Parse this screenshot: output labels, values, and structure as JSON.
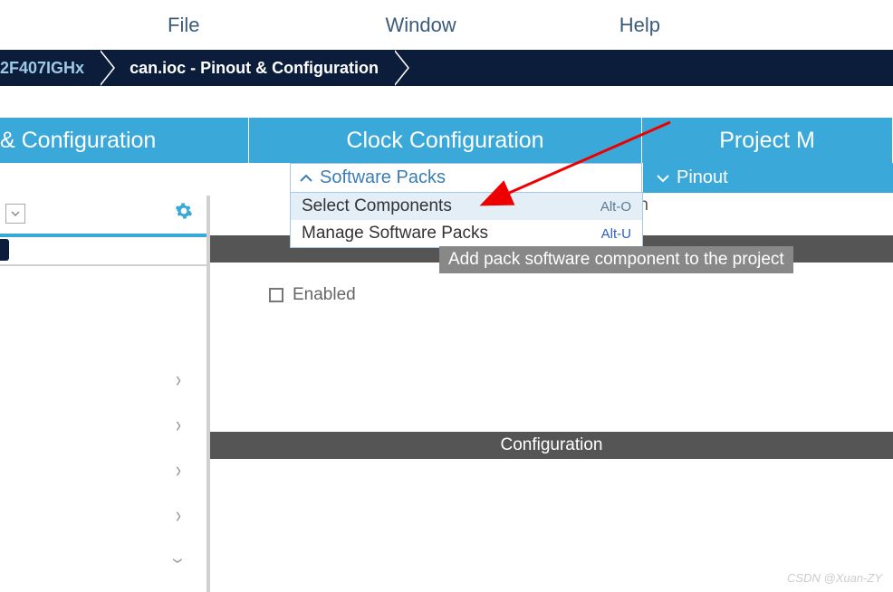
{
  "menubar": {
    "file": "File",
    "window": "Window",
    "help": "Help"
  },
  "breadcrumb": {
    "chip": "2F407IGHx",
    "current": "can.ioc - Pinout & Configuration"
  },
  "tabs": {
    "config": "& Configuration",
    "clock": "Clock Configuration",
    "project": "Project M"
  },
  "dropdown": {
    "title": "Software Packs",
    "items": [
      {
        "label": "Select Components",
        "shortcut": "Alt-O"
      },
      {
        "label": "Manage Software Packs",
        "shortcut": "Alt-U"
      }
    ]
  },
  "pinout": {
    "label": "Pinout"
  },
  "tooltip": "Add pack software component to the project",
  "truncated_text": "figuration",
  "enabled_label": "Enabled",
  "config_header": "Configuration",
  "watermark": "CSDN @Xuan-ZY"
}
